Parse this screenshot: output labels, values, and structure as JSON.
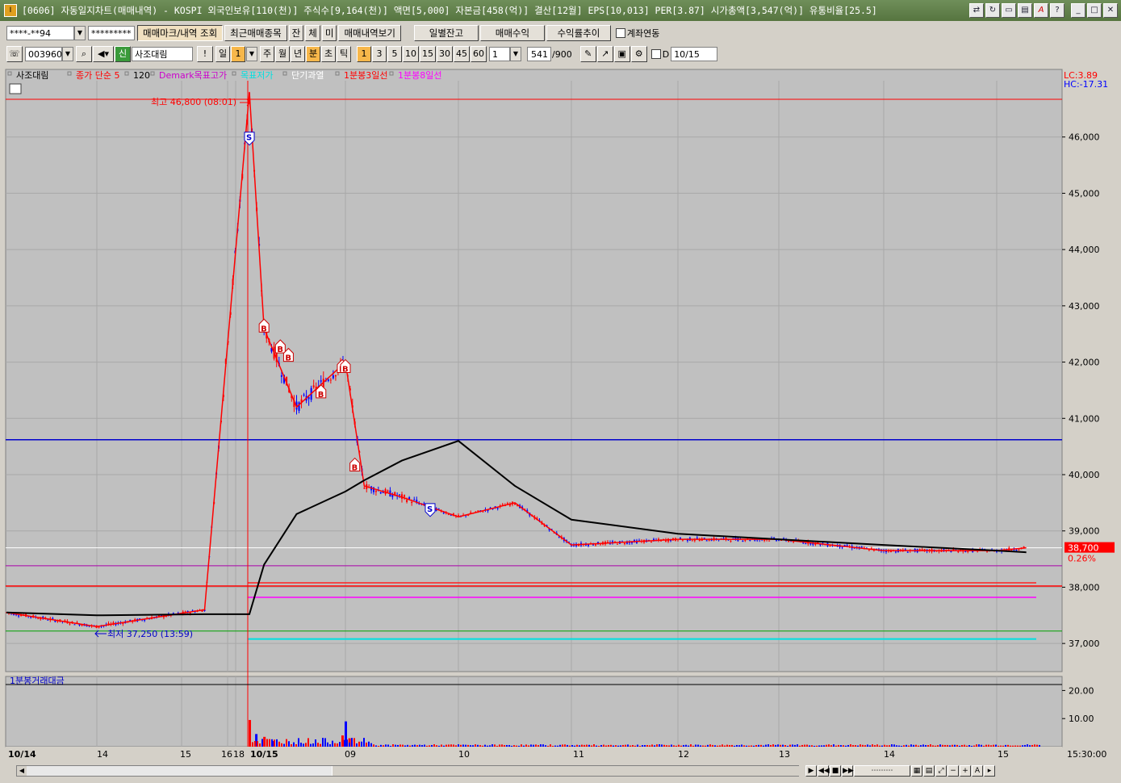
{
  "window": {
    "title": "[0606] 자동일지차트(매매내역) - KOSPI 외국인보유[110(천)] 주식수[9,164(천)] 액면[5,000] 자본금[458(억)] 결산[12월] EPS[10,013] PER[3.87] 시가총액[3,547(억)] 유통비율[25.5]",
    "icon": "app-icon"
  },
  "toolbar1": {
    "account": "****-**94",
    "password": "*********",
    "btn_trade_mark": "매매마크/내역 조회",
    "btn_recent": "최근매매종목",
    "btn_jan": "잔",
    "btn_che": "체",
    "btn_mi": "미",
    "btn_history": "매매내역보기",
    "btn_daily_balance": "일별잔고",
    "btn_trade_profit": "매매수익",
    "btn_return_trend": "수익률추이",
    "account_link_label": "계좌연동"
  },
  "toolbar2": {
    "code": "003960",
    "new_badge": "신",
    "stock_name": "사조대림",
    "exclaim": "!",
    "period_day": "일",
    "period_value": "1",
    "period_week": "주",
    "period_month": "월",
    "period_year": "년",
    "period_min": "분",
    "period_sec": "초",
    "period_tick": "틱",
    "intervals": [
      "1",
      "3",
      "5",
      "10",
      "15",
      "30",
      "45",
      "60"
    ],
    "interval_custom": "1",
    "count": "541",
    "count_max": "/900",
    "date_check_label": "D",
    "date": "10/15"
  },
  "legend": {
    "stock": "사조대림",
    "ma": "종가 단순 5",
    "ma_val": "120",
    "demark": "Demark목표고가",
    "demark_low": "목표저가",
    "overbought": "단기과열",
    "line3": "1분봉3일선",
    "line8": "1분봉8일선",
    "lc": "LC:3.89",
    "hc": "HC:-17.31"
  },
  "annotations": {
    "high": "최고 46,800 (08:01)",
    "low": "최저 37,250 (13:59)",
    "current_price": "38,700",
    "current_pct": "0.26%"
  },
  "volume_panel": {
    "label": "1분봉거래대금",
    "ticks": [
      "20.00",
      "10.00"
    ]
  },
  "time_axis": {
    "labels": [
      "10/14",
      "14",
      "15",
      "16",
      "18",
      "10/15",
      "09",
      "10",
      "11",
      "12",
      "13",
      "14",
      "15"
    ],
    "end_time": "15:30:00"
  },
  "colors": {
    "chart_bg": "#c0c0c0",
    "up": "#ff0000",
    "down": "#0000ff",
    "ma_line": "#000000",
    "blue_level": "#0000cc",
    "red_level": "#ff0000",
    "magenta_level": "#ff00ff",
    "cyan_level": "#00e0e0",
    "green_level": "#00a000",
    "white_level": "#ffffff"
  },
  "chart_data": {
    "type": "line",
    "title": "",
    "xlabel": "",
    "ylabel": "",
    "ylim": [
      36500,
      47000
    ],
    "yticks": [
      37000,
      38000,
      39000,
      40000,
      41000,
      42000,
      43000,
      44000,
      45000,
      46000
    ],
    "x": [
      "10/14 09:00",
      "10/14 13:59",
      "10/14 15:30",
      "10/15 08:01",
      "10/15 08:10",
      "10/15 08:30",
      "10/15 09:00",
      "10/15 09:10",
      "10/15 09:30",
      "10/15 10:00",
      "10/15 10:30",
      "10/15 11:00",
      "10/15 12:00",
      "10/15 13:00",
      "10/15 14:00",
      "10/15 15:00",
      "10/15 15:20"
    ],
    "series": [
      {
        "values": [
          37550,
          37300,
          37600,
          46800,
          42600,
          41200,
          42000,
          39800,
          39600,
          39250,
          39500,
          38750,
          38850,
          38850,
          38650,
          38650,
          38700
        ]
      },
      {
        "values": [
          37550,
          37500,
          37520,
          37520,
          38400,
          39300,
          39700,
          39900,
          40250,
          40600,
          39800,
          39200,
          38950,
          38850,
          38750,
          38650,
          38620
        ]
      }
    ],
    "levels": {
      "blue": 40620,
      "red": 38020,
      "magenta": 37820,
      "purple": 38380,
      "cyan": 37080,
      "green": 37220,
      "white": 38700
    },
    "markers": {
      "buy": [
        {
          "x": "10/15 08:10",
          "y": 42620
        },
        {
          "x": "10/15 08:20",
          "y": 42250
        },
        {
          "x": "10/15 08:25",
          "y": 42100
        },
        {
          "x": "10/15 08:45",
          "y": 41450
        },
        {
          "x": "10/15 08:58",
          "y": 41900
        },
        {
          "x": "10/15 09:00",
          "y": 41900
        },
        {
          "x": "10/15 09:05",
          "y": 40150
        }
      ],
      "sell": [
        {
          "x": "10/15 08:01",
          "y": 46000
        },
        {
          "x": "10/15 09:45",
          "y": 39400
        }
      ]
    },
    "volume": {
      "ylim": [
        0,
        25
      ],
      "x": [
        "10/15 08:01",
        "10/15 08:05",
        "10/15 08:10",
        "10/15 08:15",
        "10/15 08:58",
        "10/15 09:00",
        "10/15 09:02"
      ],
      "values": [
        9.5,
        4.5,
        3.5,
        2.0,
        4.0,
        9.0,
        3.0
      ]
    }
  }
}
